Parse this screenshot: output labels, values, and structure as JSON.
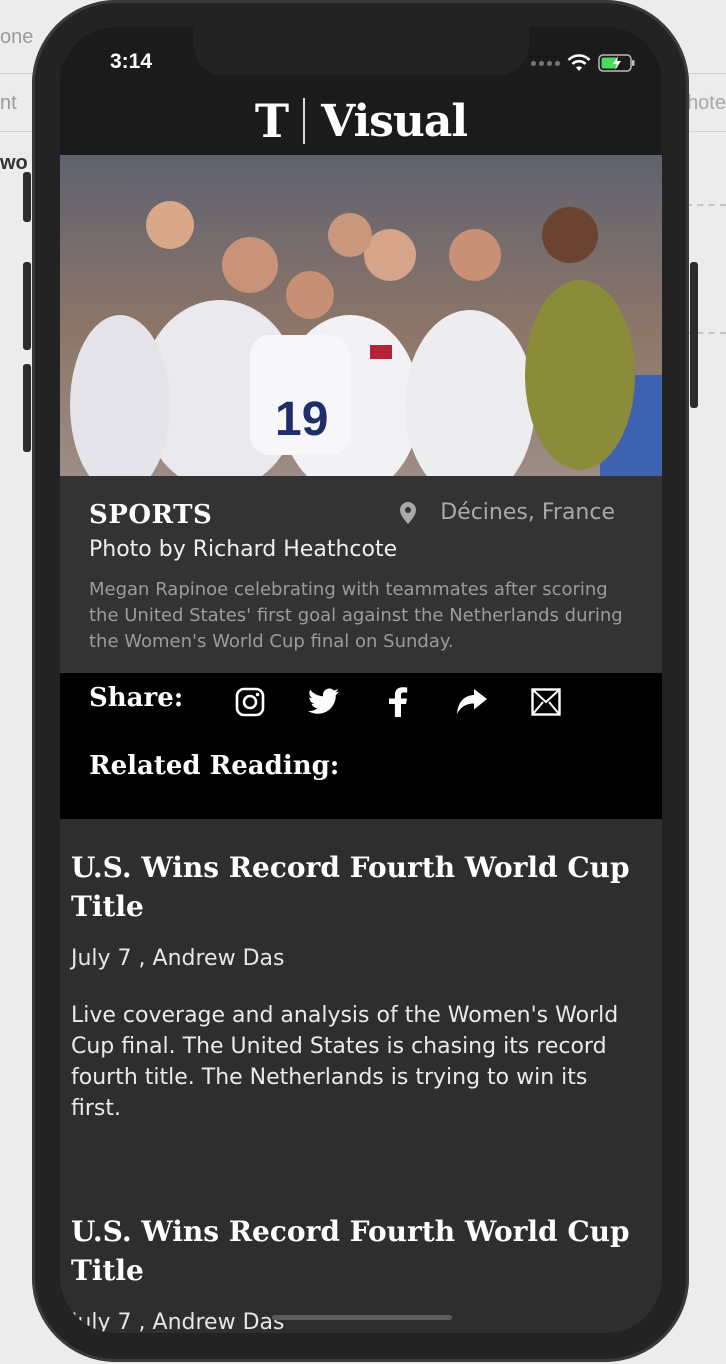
{
  "background_app": {
    "left_fragments": [
      "one",
      "nt",
      "wo"
    ],
    "right_fragments": [
      "hote"
    ]
  },
  "status_bar": {
    "time": "3:14"
  },
  "nav": {
    "logo_mark": "T",
    "title": "Visual"
  },
  "photo": {
    "alt": "Megan Rapinoe celebrating with teammates"
  },
  "caption_card": {
    "section": "SPORTS",
    "location": "Décines, France",
    "credit": "Photo by Richard Heathcote",
    "caption": "Megan Rapinoe celebrating with teammates after scoring the United States' first goal against the Netherlands during the Women's World Cup final on Sunday."
  },
  "share": {
    "label": "Share:",
    "icons": [
      "instagram-icon",
      "twitter-icon",
      "facebook-icon",
      "forward-icon",
      "mail-icon"
    ]
  },
  "related": {
    "label": "Related Reading:",
    "articles": [
      {
        "title": "U.S. Wins Record Fourth World Cup Title",
        "meta": "July 7 , Andrew Das",
        "summary": "Live coverage and analysis of the Women's World Cup final. The United States is chasing its record fourth title. The Netherlands is trying to win its first."
      },
      {
        "title": "U.S. Wins Record Fourth World Cup Title",
        "meta": "July 7 , Andrew Das"
      }
    ]
  },
  "colors": {
    "screen_bg": "#1b1b1b",
    "caption_bg": "#333333",
    "share_bg": "#000000",
    "articles_bg": "#2e2e2e",
    "battery_green": "#4cd964"
  }
}
